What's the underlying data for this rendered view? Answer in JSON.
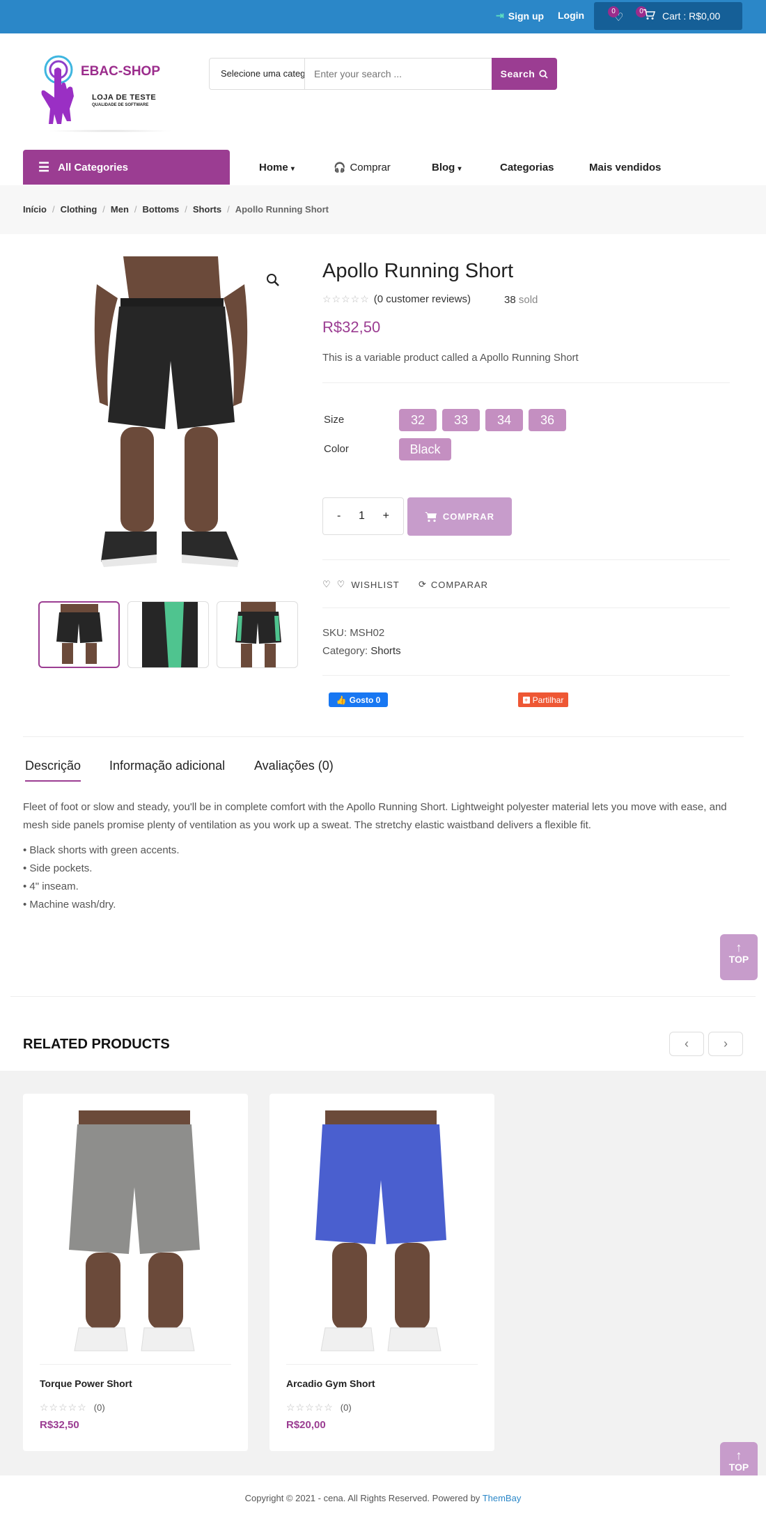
{
  "topbar": {
    "signup": "Sign up",
    "login": "Login",
    "wishlist_count": "0",
    "cart_count": "0",
    "cart_label": "Cart : R$0,00"
  },
  "header": {
    "brand": "EBAC-SHOP",
    "tagline1": "LOJA DE TESTE",
    "tagline2": "QUALIDADE DE SOFTWARE",
    "category_select": "Selecione uma categoria",
    "search_placeholder": "Enter your search ...",
    "search_button": "Search"
  },
  "nav": {
    "all_categories": "All Categories",
    "items": [
      "Home",
      "Comprar",
      "Blog",
      "Categorias",
      "Mais vendidos"
    ]
  },
  "breadcrumb": [
    "Início",
    "Clothing",
    "Men",
    "Bottoms",
    "Shorts",
    "Apollo Running Short"
  ],
  "product": {
    "title": "Apollo Running Short",
    "reviews": "(0 customer reviews)",
    "sold_count": "38",
    "sold_label": "sold",
    "price": "R$32,50",
    "short_description": "This is a variable product called a Apollo Running Short",
    "size_label": "Size",
    "sizes": [
      "32",
      "33",
      "34",
      "36"
    ],
    "color_label": "Color",
    "colors": [
      "Black"
    ],
    "qty_minus": "-",
    "qty_value": "1",
    "qty_plus": "+",
    "buy_button": "COMPRAR",
    "wishlist": "WISHLIST",
    "compare": "COMPARAR",
    "sku_label": "SKU:",
    "sku": "MSH02",
    "category_label": "Category:",
    "category": "Shorts",
    "fb_like": "Gosto 0",
    "share": "Partilhar"
  },
  "tabs": [
    "Descrição",
    "Informação adicional",
    "Avaliações (0)"
  ],
  "description": {
    "text": "Fleet of foot or slow and steady, you'll be in complete comfort with the Apollo Running Short. Lightweight polyester material lets you move with ease, and mesh side panels promise plenty of ventilation as you work up a sweat. The stretchy elastic waistband delivers a flexible fit.",
    "bullets": [
      "• Black shorts with green accents.",
      "• Side pockets.",
      "• 4\" inseam.",
      "• Machine wash/dry."
    ]
  },
  "to_top": "TOP",
  "related": {
    "title": "RELATED PRODUCTS",
    "items": [
      {
        "name": "Torque Power Short",
        "reviews": "(0)",
        "price": "R$32,50",
        "short_color": "#8e8e8c"
      },
      {
        "name": "Arcadio Gym Short",
        "reviews": "(0)",
        "price": "R$20,00",
        "short_color": "#4a5fcf"
      }
    ]
  },
  "footer": {
    "text": "Copyright © 2021 - cena. All Rights Reserved. Powered by ",
    "link": "ThemBay"
  },
  "colors": {
    "topbar": "#2b87c8",
    "accent": "#9b3d92",
    "swatch": "#c48fc1"
  }
}
